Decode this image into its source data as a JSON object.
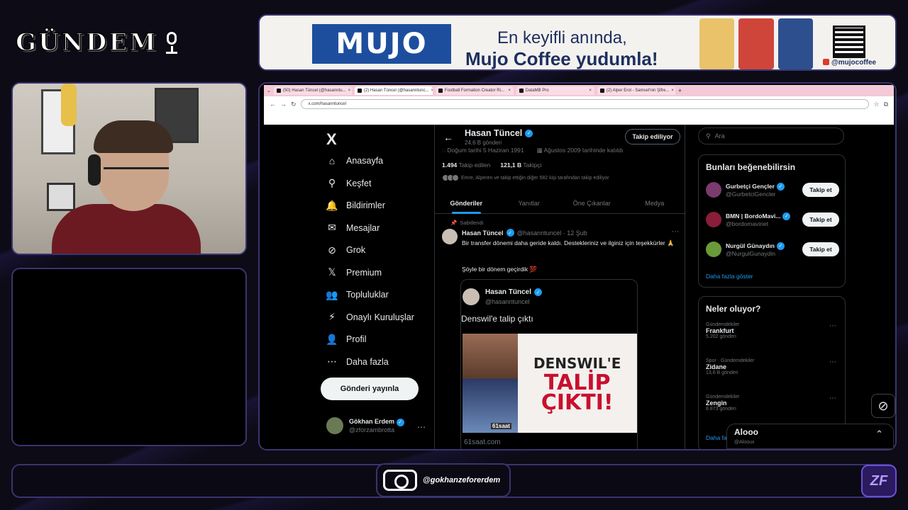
{
  "overlay": {
    "logo_text": "GÜNDEM",
    "instagram_handle": "@gokhanzeforerdem",
    "corner_logo": "ZF"
  },
  "ad": {
    "brand": "MUJO",
    "line1": "En keyifli anında,",
    "line2": "Mujo Coffee yudumla!",
    "social": "@mujocoffee"
  },
  "browser": {
    "tabs": [
      {
        "label": "(50) Hasan Tüncel (@hasanntu...",
        "active": false
      },
      {
        "label": "(2) Hasan Tüncel (@hasanntunc...",
        "active": true
      },
      {
        "label": "Football Formation Creator Ri...",
        "active": false
      },
      {
        "label": "DataMB Pro",
        "active": false
      },
      {
        "label": "(2) Alper Erol - Samsel'nin Şifre...",
        "active": false
      }
    ],
    "url": "x.com/hasanntuncel"
  },
  "x": {
    "logo": "X",
    "nav": [
      {
        "icon": "home-icon",
        "glyph": "⌂",
        "label": "Anasayfa"
      },
      {
        "icon": "search-icon",
        "glyph": "⚲",
        "label": "Keşfet"
      },
      {
        "icon": "bell-icon",
        "glyph": "🔔",
        "label": "Bildirimler"
      },
      {
        "icon": "mail-icon",
        "glyph": "✉",
        "label": "Mesajlar"
      },
      {
        "icon": "grok-icon",
        "glyph": "⊘",
        "label": "Grok"
      },
      {
        "icon": "x-premium-icon",
        "glyph": "𝕏",
        "label": "Premium"
      },
      {
        "icon": "communities-icon",
        "glyph": "👥",
        "label": "Topluluklar"
      },
      {
        "icon": "lightning-icon",
        "glyph": "⚡",
        "label": "Onaylı Kuruluşlar"
      },
      {
        "icon": "profile-icon",
        "glyph": "👤",
        "label": "Profil"
      },
      {
        "icon": "more-circle-icon",
        "glyph": "⋯",
        "label": "Daha fazla"
      }
    ],
    "post_button": "Gönderi yayınla",
    "me": {
      "name": "Gökhan Erdem",
      "handle": "@zforzambrotta"
    },
    "profile": {
      "name": "Hasan Tüncel",
      "post_count": "24,6 B gönderi",
      "following_button": "Takip ediliyor",
      "birth": "Doğum tarihi 5 Haziran 1991",
      "joined": "Ağustos 2009 tarihinde katıldı",
      "following_num": "1.494",
      "following_label": "Takip edilen",
      "followers_num": "121,1 B",
      "followers_label": "Takipçi",
      "followed_by": "Emre, Alperen ve takip ettiğin diğer 582 kişi tarafından takip ediliyor",
      "tabs": [
        "Gönderiler",
        "Yanıtlar",
        "Öne Çıkanlar",
        "Medya"
      ]
    },
    "tweet": {
      "pinned": "Sabitlendi",
      "name": "Hasan Tüncel",
      "handle": "@hasanntuncel · 12 Şub",
      "text": "Bir transfer dönemi daha geride kaldı. Destekleriniz ve ilginiz için teşekkürler 🙏",
      "text2": "Şöyle bir dönem geçirdik 💯",
      "quote": {
        "name": "Hasan Tüncel",
        "handle": "@hasanntuncel",
        "text": "Denswil'e talip çıktı",
        "headline1": "DENSWIL'E",
        "headline2": "TALİP",
        "headline3": "ÇIKTI!",
        "badge": "61saat",
        "source": "61saat.com"
      }
    },
    "search_placeholder": "Ara",
    "suggestions": {
      "title": "Bunları beğenebilirsin",
      "items": [
        {
          "name": "Gurbetçi Gençler",
          "handle": "@GurbetciGencler",
          "button": "Takip et",
          "color": "#7a3b6e"
        },
        {
          "name": "BMN | BordoMavi...",
          "handle": "@bordomavinet",
          "button": "Takip et",
          "color": "#8a1e3a"
        },
        {
          "name": "Nurgül Günaydın",
          "handle": "@NurgulGunaydin",
          "button": "Takip et",
          "color": "#6b9a3a"
        }
      ],
      "more": "Daha fazla göster"
    },
    "trends": {
      "title": "Neler oluyor?",
      "items": [
        {
          "category": "Gündemdekiler",
          "topic": "Frankfurt",
          "count": "5.202 gönderi"
        },
        {
          "category": "Spor · Gündemdekiler",
          "topic": "Zidane",
          "count": "13,6 B gönderi"
        },
        {
          "category": "Gündemdekiler",
          "topic": "Zengin",
          "count": "8.873 gönderi"
        }
      ],
      "more": "Daha fazla göster"
    },
    "messages": {
      "title": "Alooo",
      "handle": "@Alooux"
    }
  }
}
